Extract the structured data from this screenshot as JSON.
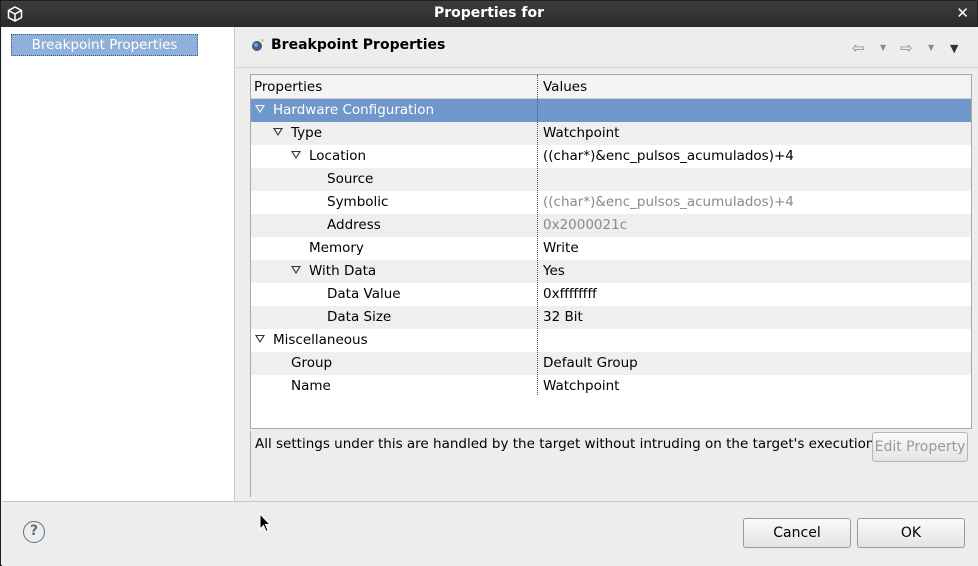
{
  "window": {
    "title": "Properties for",
    "close_glyph": "✕"
  },
  "nav": {
    "items": [
      {
        "label": "Breakpoint Properties",
        "selected": true
      }
    ]
  },
  "panel": {
    "title": "Breakpoint Properties",
    "back_glyph": "⇦",
    "forward_glyph": "⇨",
    "menu_glyph": "▼",
    "dropdown_glyph": "▼"
  },
  "table": {
    "headers": {
      "properties": "Properties",
      "values": "Values"
    },
    "rows": [
      {
        "label": "Hardware Configuration",
        "value": "",
        "level": 0,
        "expanded": true,
        "selected": true
      },
      {
        "label": "Type",
        "value": "Watchpoint",
        "level": 1,
        "expanded": true
      },
      {
        "label": "Location",
        "value": "((char*)&enc_pulsos_acumulados)+4",
        "level": 2,
        "expanded": true
      },
      {
        "label": "Source",
        "value": "",
        "level": 3
      },
      {
        "label": "Symbolic",
        "value": "((char*)&enc_pulsos_acumulados)+4",
        "level": 3,
        "dim": true
      },
      {
        "label": "Address",
        "value": "0x2000021c",
        "level": 3,
        "dim": true
      },
      {
        "label": "Memory",
        "value": "Write",
        "level": 2
      },
      {
        "label": "With Data",
        "value": "Yes",
        "level": 2,
        "expanded": true
      },
      {
        "label": "Data Value",
        "value": "0xffffffff",
        "level": 3
      },
      {
        "label": "Data Size",
        "value": "32 Bit",
        "level": 3
      },
      {
        "label": "Miscellaneous",
        "value": "",
        "level": 0,
        "expanded": true
      },
      {
        "label": "Group",
        "value": "Default Group",
        "level": 1
      },
      {
        "label": "Name",
        "value": "Watchpoint",
        "level": 1
      }
    ]
  },
  "description": {
    "text": "All settings under this are handled by the target without intruding on the target's execution",
    "edit_button": "Edit Property"
  },
  "buttons": {
    "help": "?",
    "cancel": "Cancel",
    "ok": "OK"
  },
  "icons": {
    "app": "cube-icon",
    "breakpoint": "breakpoint-icon",
    "back": "back-arrow-icon",
    "forward": "forward-arrow-icon",
    "help": "help-icon",
    "twisty": "triangle-down-icon"
  }
}
